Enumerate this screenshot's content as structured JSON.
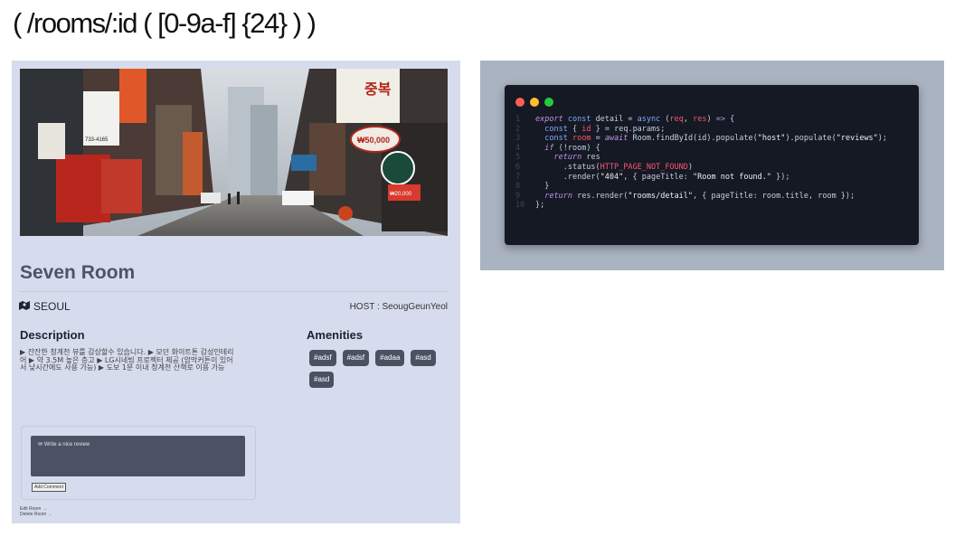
{
  "route_title": "( /rooms/:id ( [0-9a-f] {24} ) )",
  "room": {
    "name": "Seven Room",
    "city": "SEOUL",
    "city_icon": "map-icon",
    "host": "HOST : SeougGeunYeol",
    "description_title": "Description",
    "description": "▶ 잔잔한 청계천 뷰를 감상할수 있습니다. ▶ 모던 화이트톤 감성인테리어 ▶ 약 3.5M 높은 층고 ▶ LG시네빔 프로젝터 제공 (암막커튼이 있어서 낮시간에도 사용 가능) ▶ 도보 1분 이내 청계천 산책로 이용 가능",
    "amenities_title": "Amenities",
    "amenities": [
      "#adsf",
      "#adsf",
      "#adaa",
      "#asd",
      "#asd"
    ],
    "review_placeholder": "✉ Write a nice review",
    "add_comment_label": "Add Comment",
    "edit_link": "Edit Room →",
    "delete_link": "Delete Room →",
    "hero_signs": {
      "sign1": "중복",
      "sign2": "₩50,000",
      "sign3": "₩20,000",
      "sign4": "733-4165"
    }
  },
  "code": {
    "window_dots": [
      "#ff5f56",
      "#ffbd2e",
      "#27c93f"
    ],
    "line_numbers": [
      "1",
      "2",
      "3",
      "4",
      "5",
      "6",
      "7",
      "8",
      "9",
      "10"
    ]
  }
}
